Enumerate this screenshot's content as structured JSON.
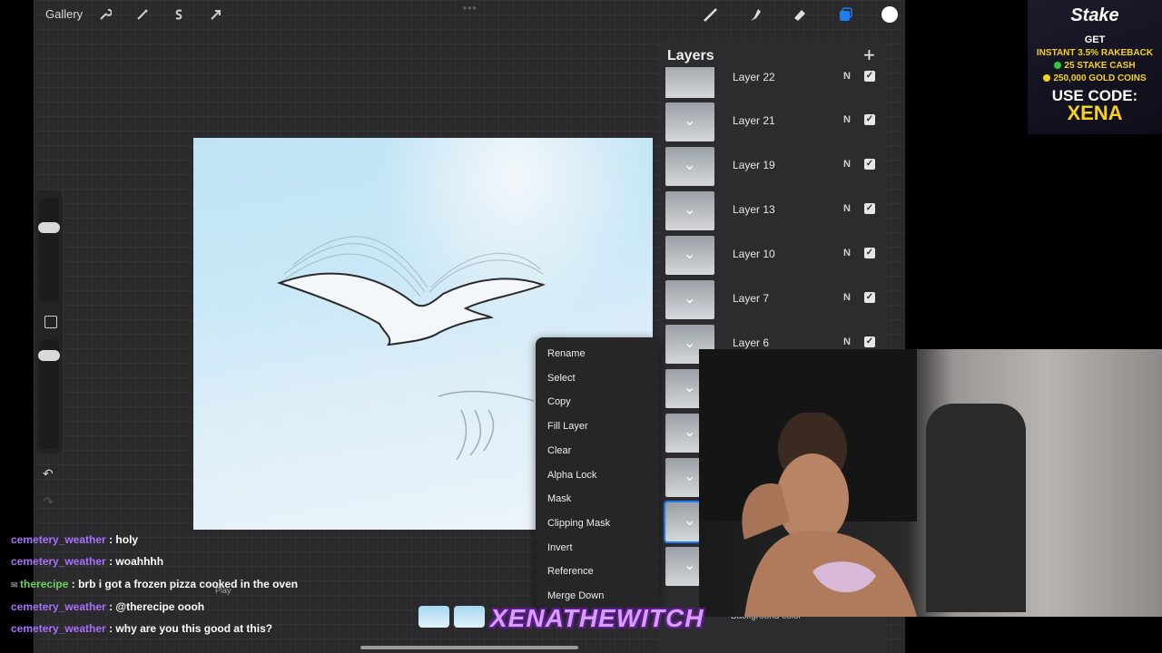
{
  "topbar": {
    "gallery_label": "Gallery",
    "tools_left": [
      "wrench-icon",
      "magic-wand-icon",
      "selection-s-icon",
      "transform-arrow-icon"
    ],
    "tools_right": [
      "brush-icon",
      "smudge-icon",
      "eraser-icon",
      "layers-icon",
      "color-icon"
    ],
    "active_tool_color": "#1e7cf2",
    "current_color": "#ffffff"
  },
  "layers_panel": {
    "title": "Layers",
    "add_symbol": "+",
    "items": [
      {
        "name": "Layer 22",
        "mode": "N",
        "visible": true
      },
      {
        "name": "Layer 21",
        "mode": "N",
        "visible": true
      },
      {
        "name": "Layer 19",
        "mode": "N",
        "visible": true
      },
      {
        "name": "Layer 13",
        "mode": "N",
        "visible": true
      },
      {
        "name": "Layer 10",
        "mode": "N",
        "visible": true
      },
      {
        "name": "Layer 7",
        "mode": "N",
        "visible": true
      },
      {
        "name": "Layer 6",
        "mode": "N",
        "visible": true
      }
    ],
    "background_label": "Background color"
  },
  "context_menu": {
    "items": [
      "Rename",
      "Select",
      "Copy",
      "Fill Layer",
      "Clear",
      "Alpha Lock",
      "Mask",
      "Clipping Mask",
      "Invert",
      "Reference",
      "Merge Down"
    ]
  },
  "ad": {
    "brand": "Stake",
    "get": "GET",
    "line1": "INSTANT 3.5% RAKEBACK",
    "line2": "25 STAKE CASH",
    "line3": "250,000 GOLD COINS",
    "use_code": "USE CODE:",
    "code": "XENA"
  },
  "chat": [
    {
      "user": "cemetery_weather",
      "message": "holy",
      "color": "#a970ff"
    },
    {
      "user": "cemetery_weather",
      "message": "woahhhh",
      "color": "#a970ff"
    },
    {
      "user": "therecipe",
      "message": "brb i got a frozen pizza cooked in the oven",
      "color": "#6bd35b"
    },
    {
      "user": "cemetery_weather",
      "message": "@therecipe oooh",
      "color": "#a970ff"
    },
    {
      "user": "cemetery_weather",
      "message": "why are you this good at this?",
      "color": "#a970ff"
    }
  ],
  "chat_separator": " : ",
  "play_label": "Play",
  "watermark": "XENATHEWITCH"
}
